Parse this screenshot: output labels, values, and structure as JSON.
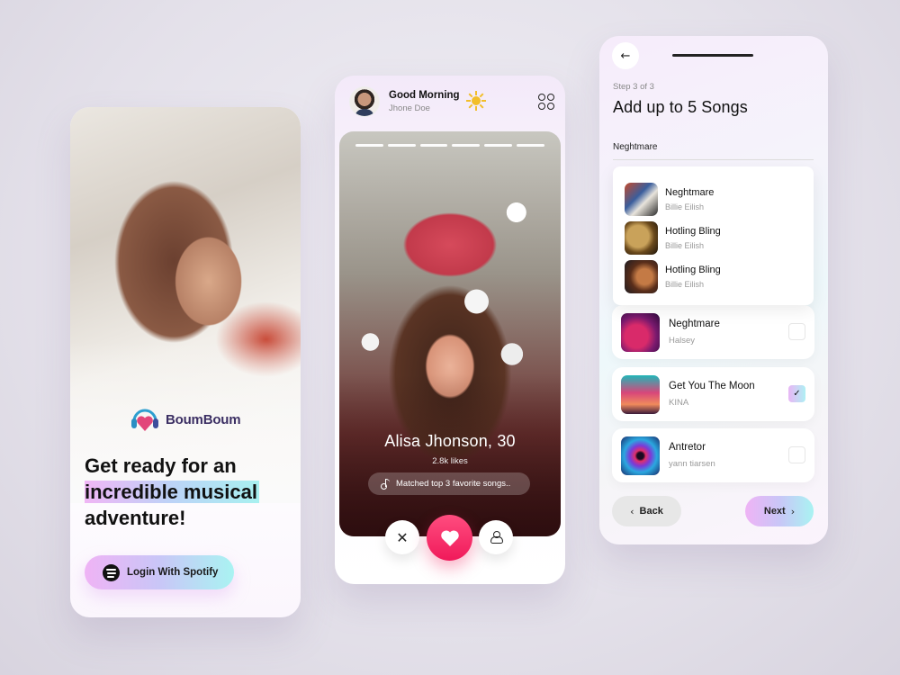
{
  "onboarding": {
    "brand_name": "BoumBoum",
    "headline_line1": "Get ready for an",
    "headline_highlight": "incredible musical",
    "headline_line3": "adventure!",
    "login_button_label": "Login With Spotify",
    "icons": {
      "logo": "heart-headphones-logo",
      "spotify": "spotify-icon"
    },
    "colors": {
      "gradient_start": "#efb3f5",
      "gradient_end": "#a9f3f2",
      "brand_text": "#3b2f63"
    }
  },
  "discover": {
    "greeting": "Good Morning",
    "user_name": "Jhone Doe",
    "icons": {
      "weather": "sun-icon",
      "menu": "grid-icon",
      "music": "music-note-icon",
      "dislike": "close-icon",
      "like": "heart-icon",
      "profile": "user-icon"
    },
    "story_segments": 6,
    "profile": {
      "name_age": "Alisa Jhonson, 30",
      "likes": "2.8k likes",
      "match_text": "Matched top 3 favorite songs.."
    },
    "colors": {
      "like_button": "#f0195a"
    }
  },
  "add_songs": {
    "step_label": "Step 3 of 3",
    "title": "Add up to 5 Songs",
    "search_value": "Neghtmare",
    "suggestions": [
      {
        "title": "Neghtmare",
        "artist": "Billie Eilish"
      },
      {
        "title": "Hotling Bling",
        "artist": "Billie Eilish"
      },
      {
        "title": "Hotling Bling",
        "artist": "Billie Eilish"
      }
    ],
    "songs": [
      {
        "title": "Neghtmare",
        "artist": "Halsey",
        "selected": false
      },
      {
        "title": "Get You The Moon",
        "artist": "KINA",
        "selected": true
      },
      {
        "title": "Antretor",
        "artist": "yann tiarsen",
        "selected": false
      }
    ],
    "check_mark": "✓",
    "back_label": "Back",
    "next_label": "Next",
    "back_arrow": "←",
    "chevron_left": "‹",
    "chevron_right": "›",
    "close_glyph": "✕"
  }
}
